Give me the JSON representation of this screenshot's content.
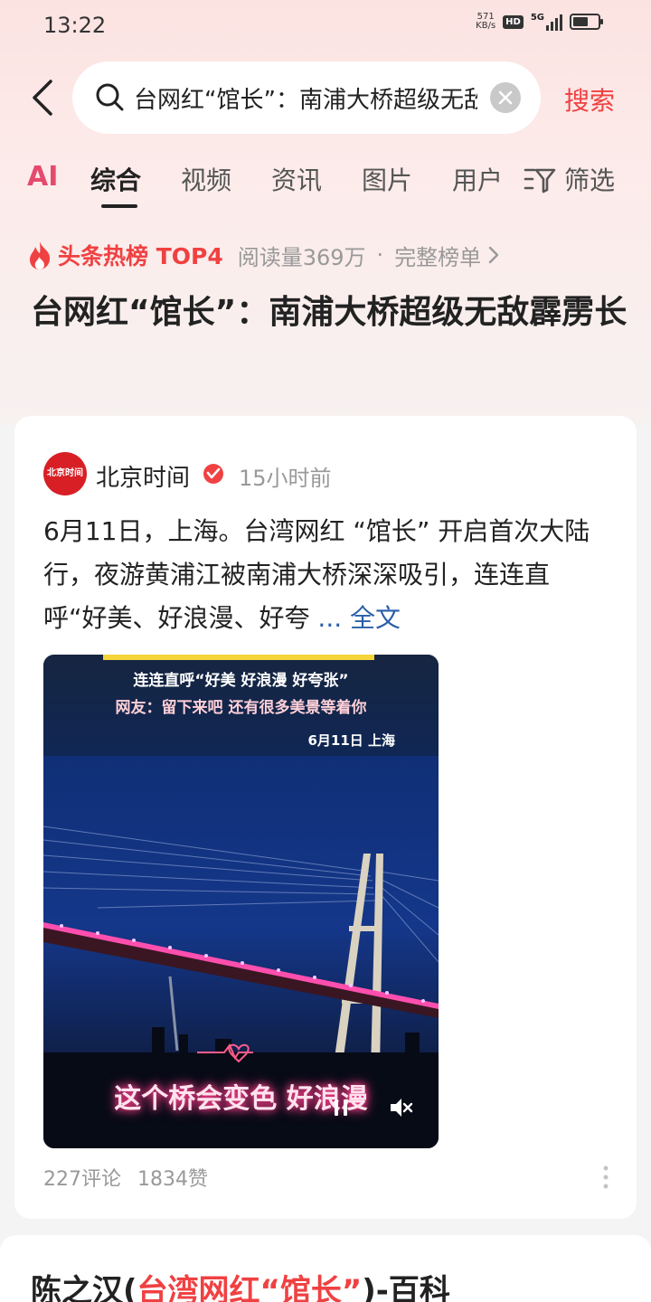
{
  "status_bar": {
    "time": "13:22",
    "net_speed_value": "571",
    "net_speed_unit": "KB/s",
    "hd": "HD",
    "network": "5G"
  },
  "search": {
    "query": "台网红“馆长”：南浦大桥超级无敌霹雳长",
    "button_label": "搜索"
  },
  "tabs": [
    {
      "label": "AI"
    },
    {
      "label": "综合"
    },
    {
      "label": "视频"
    },
    {
      "label": "资讯"
    },
    {
      "label": "图片"
    },
    {
      "label": "用户"
    },
    {
      "label": "筛选"
    }
  ],
  "hot": {
    "label": "头条热榜 TOP4",
    "reads": "阅读量369万",
    "dot": "·",
    "link": "完整榜单"
  },
  "headline": "台网红“馆长”：南浦大桥超级无敌霹雳长",
  "card": {
    "logo_text": "北京时间",
    "source": "北京时间",
    "time": "15小时前",
    "text": "6月11日，上海。台湾网红 “馆长” 开启首次大陆行，夜游黄浦江被南浦大桥深深吸引，连连直呼“好美、好浪漫、好夸",
    "more": "... 全文",
    "video": {
      "caption1": "连连直呼“好美 好浪漫 好夸张”",
      "caption2": "网友：留下来吧 还有很多美景等着你",
      "date": "6月11日 上海",
      "subtitle": "这个桥会变色 好浪漫"
    },
    "comments": "227评论",
    "likes": "1834赞"
  },
  "card2": {
    "title_prefix": "陈之汉(",
    "title_highlight": "台湾网红“馆长”",
    "title_suffix": ")-百科"
  },
  "colors": {
    "accent": "#f04142",
    "link": "#2a5ea8"
  }
}
